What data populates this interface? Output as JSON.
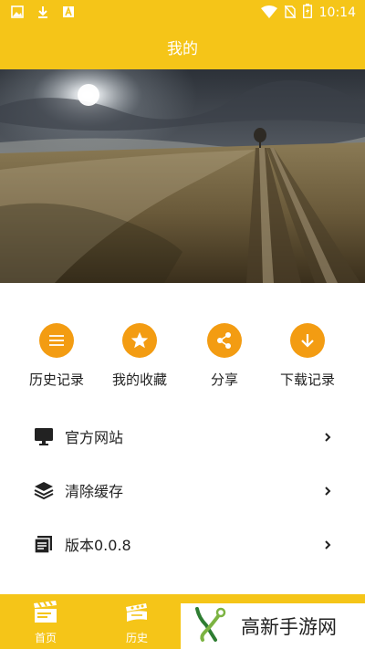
{
  "status_bar": {
    "time": "10:14",
    "left_icons": [
      "image-icon",
      "download-icon",
      "a-icon"
    ],
    "right_icons": [
      "wifi-icon",
      "no-sim-icon",
      "battery-charging-icon"
    ]
  },
  "header": {
    "title": "我的"
  },
  "banner": {
    "description_icon": "landscape-image"
  },
  "quick_actions": [
    {
      "label": "历史记录",
      "icon": "list-icon"
    },
    {
      "label": "我的收藏",
      "icon": "star-icon"
    },
    {
      "label": "分享",
      "icon": "share-icon"
    },
    {
      "label": "下载记录",
      "icon": "download-arrow-icon"
    }
  ],
  "menu": [
    {
      "label": "官方网站",
      "icon": "monitor-icon"
    },
    {
      "label": "清除缓存",
      "icon": "layers-icon"
    },
    {
      "label": "版本0.0.8",
      "icon": "document-icon"
    }
  ],
  "bottom_nav": [
    {
      "label": "首页",
      "icon": "clapperboard-icon"
    },
    {
      "label": "历史",
      "icon": "film-reel-icon"
    }
  ],
  "watermark": {
    "text": "高新手游网"
  },
  "colors": {
    "primary": "#f5c518",
    "accent": "#f39c12",
    "text": "#222222"
  }
}
